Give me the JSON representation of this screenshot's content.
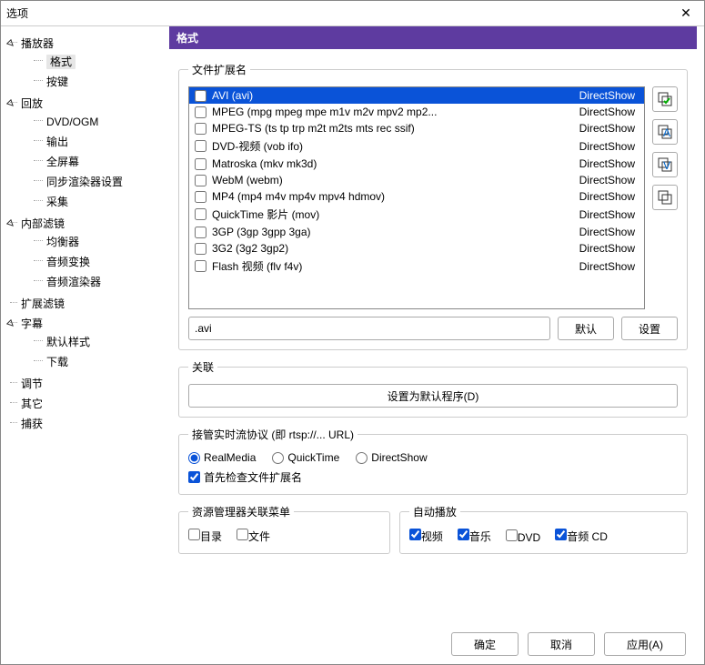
{
  "window": {
    "title": "选项"
  },
  "sidebar": {
    "nodes": [
      {
        "label": "播放器",
        "children": [
          {
            "label": "格式",
            "selected": true
          },
          {
            "label": "按键"
          }
        ]
      },
      {
        "label": "回放",
        "children": [
          {
            "label": "DVD/OGM"
          },
          {
            "label": "输出"
          },
          {
            "label": "全屏幕"
          },
          {
            "label": "同步渲染器设置"
          },
          {
            "label": "采集"
          }
        ]
      },
      {
        "label": "内部滤镜",
        "children": [
          {
            "label": "均衡器"
          },
          {
            "label": "音频变换"
          },
          {
            "label": "音频渲染器"
          }
        ]
      },
      {
        "label": "扩展滤镜"
      },
      {
        "label": "字幕",
        "children": [
          {
            "label": "默认样式"
          },
          {
            "label": "下载"
          }
        ]
      },
      {
        "label": "调节"
      },
      {
        "label": "其它"
      },
      {
        "label": "捕获"
      }
    ]
  },
  "header": {
    "title": "格式"
  },
  "ext": {
    "legend": "文件扩展名",
    "rows": [
      {
        "name": "AVI (avi)",
        "engine": "DirectShow",
        "checked": false,
        "selected": true
      },
      {
        "name": "MPEG (mpg mpeg mpe m1v m2v mpv2 mp2...",
        "engine": "DirectShow",
        "checked": false
      },
      {
        "name": "MPEG-TS (ts tp trp m2t m2ts mts rec ssif)",
        "engine": "DirectShow",
        "checked": false
      },
      {
        "name": "DVD-视频 (vob ifo)",
        "engine": "DirectShow",
        "checked": false
      },
      {
        "name": "Matroska (mkv mk3d)",
        "engine": "DirectShow",
        "checked": false
      },
      {
        "name": "WebM (webm)",
        "engine": "DirectShow",
        "checked": false
      },
      {
        "name": "MP4 (mp4 m4v mp4v mpv4 hdmov)",
        "engine": "DirectShow",
        "checked": false
      },
      {
        "name": "QuickTime 影片 (mov)",
        "engine": "DirectShow",
        "checked": false
      },
      {
        "name": "3GP (3gp 3gpp 3ga)",
        "engine": "DirectShow",
        "checked": false
      },
      {
        "name": "3G2 (3g2 3gp2)",
        "engine": "DirectShow",
        "checked": false
      },
      {
        "name": "Flash 视频 (flv f4v)",
        "engine": "DirectShow",
        "checked": false
      }
    ],
    "input_value": ".avi",
    "default_btn": "默认",
    "set_btn": "设置",
    "icons": [
      "check-all",
      "select-all-a",
      "select-video",
      "select-none"
    ]
  },
  "assoc": {
    "legend": "关联",
    "btn": "设置为默认程序(D)"
  },
  "rtsp": {
    "legend": "接管实时流协议 (即 rtsp://... URL)",
    "options": [
      {
        "label": "RealMedia",
        "checked": true
      },
      {
        "label": "QuickTime",
        "checked": false
      },
      {
        "label": "DirectShow",
        "checked": false
      }
    ],
    "check_ext": {
      "label": "首先检查文件扩展名",
      "checked": true
    }
  },
  "context": {
    "legend": "资源管理器关联菜单",
    "items": [
      {
        "label": "目录",
        "checked": false
      },
      {
        "label": "文件",
        "checked": false
      }
    ]
  },
  "autoplay": {
    "legend": "自动播放",
    "items": [
      {
        "label": "视频",
        "checked": true
      },
      {
        "label": "音乐",
        "checked": true
      },
      {
        "label": "DVD",
        "checked": false
      },
      {
        "label": "音频 CD",
        "checked": true
      }
    ]
  },
  "footer": {
    "ok": "确定",
    "cancel": "取消",
    "apply": "应用(A)"
  }
}
